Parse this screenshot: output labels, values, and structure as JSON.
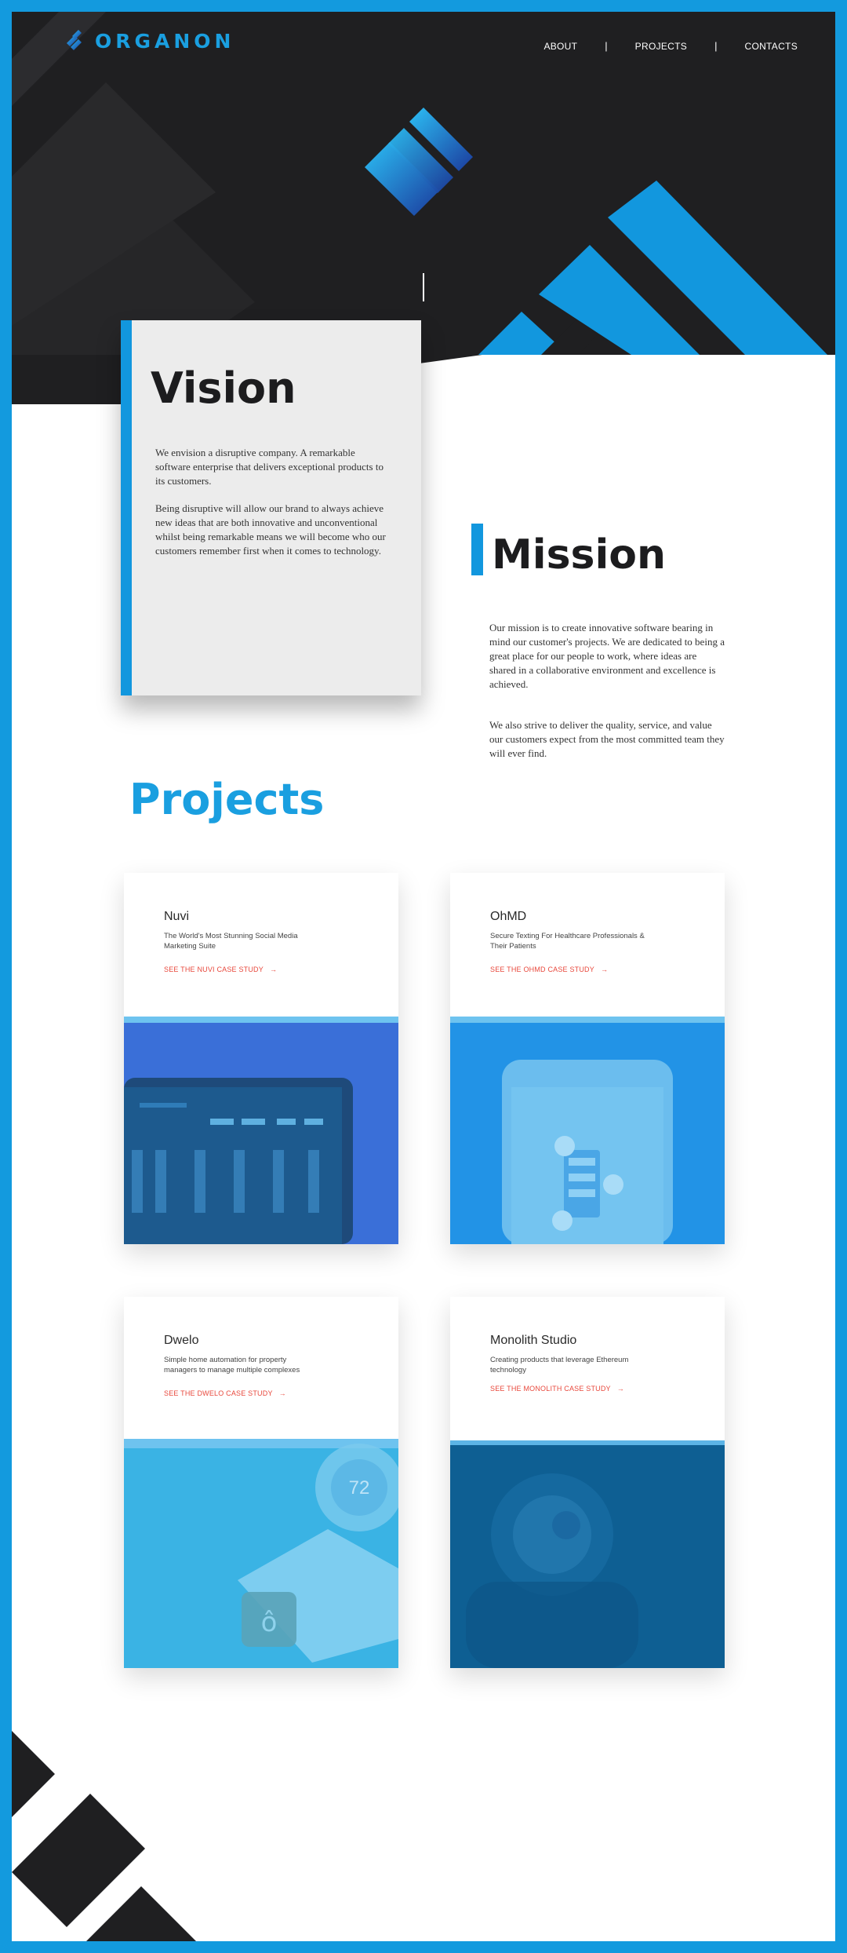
{
  "brand": {
    "name": "ORGANON",
    "accent": "#139ade",
    "dark": "#1f1f21"
  },
  "nav": {
    "items": [
      "ABOUT",
      "PROJECTS",
      "CONTACTS"
    ],
    "separator": "|"
  },
  "vision": {
    "title": "Vision",
    "paragraphs": [
      "We envision a disruptive company. A remarkable software enterprise that delivers exceptional products to its customers.",
      "Being disruptive will allow our brand to always achieve new ideas that are both innovative and unconventional whilst being remarkable means we will become who our customers remember first when it comes to technology."
    ]
  },
  "mission": {
    "title": "Mission",
    "paragraphs": [
      "Our mission is to create innovative software bearing in mind our customer's projects. We are dedicated to being a great place for our people to work, where ideas are shared in a collaborative environment and excellence is achieved.",
      "We also strive to deliver the quality, service, and value our customers expect from the most committed team they will ever find."
    ]
  },
  "projects": {
    "title": "Projects",
    "items": [
      {
        "name": "Nuvi",
        "description": "The World's Most Stunning Social Media Marketing Suite",
        "link": "SEE THE NUVI CASE STUDY",
        "color": "#3a6fd8"
      },
      {
        "name": "OhMD",
        "description": "Secure Texting For Healthcare Professionals & Their Patients",
        "link": "SEE THE OHMD CASE STUDY",
        "color": "#2293e6"
      },
      {
        "name": "Dwelo",
        "description": "Simple home automation for property managers to manage multiple complexes",
        "link": "SEE THE DWELO CASE STUDY",
        "color": "#3ab3e4"
      },
      {
        "name": "Monolith Studio",
        "description": "Creating products that leverage Ethereum technology",
        "link": "SEE THE MONOLITH CASE STUDY",
        "color": "#0e5f93"
      }
    ]
  },
  "icons": {
    "arrow": "right-arrow-icon",
    "logo": "organon-logo-icon"
  },
  "dwelo_thermostat": "72"
}
